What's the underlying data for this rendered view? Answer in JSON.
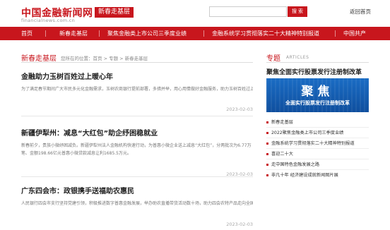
{
  "header": {
    "logo_cn": "中国金融新闻网",
    "logo_en": "financialnews.com.cn",
    "channel": "新春走基层",
    "search_placeholder": "",
    "search_label": "搜 索",
    "home_label": "返回首页"
  },
  "nav": {
    "items": [
      {
        "label": "首页"
      },
      {
        "label": "新春走基层"
      },
      {
        "label": "聚焦金融类上市公司三季度业绩"
      },
      {
        "label": "金融系统学习贯彻落实二十大精神特别报道"
      },
      {
        "label": "中国共产"
      }
    ]
  },
  "main": {
    "section_title": "新春走基层",
    "breadcrumb": "您所在的位置：首页 > 专题 > 新春走基层",
    "articles": [
      {
        "title": "金融助力玉树百姓过上暖心年",
        "summary": "为了满足春节期间广大市民多元化金融需求，玉树农商银行提前部署，多措并举，用心用情做好金融服务，助力玉树百姓过上暖心",
        "date": "2023-02-03"
      },
      {
        "title": "新疆伊犁州：减息“大红包”助企纾困稳就业",
        "summary": "新春前夕，贵族小微纾困减负。新疆伊犁州法人金融机构快速行动，为普惠小微企业送上减息“大红包”，分两批次为6.77万笔、金额198.66亿元普惠小微贷款减息让利1685.5万元。",
        "date": "2023-02-03"
      },
      {
        "title": "广东四会市：政银携手送福助农惠民",
        "summary": "人民银行四会市支行坚持党建引领，积极推进数字普惠金融发展，举办助农直播带货活动数十场，助力四会农特产品走向全国。",
        "date": "2023-02-03"
      }
    ]
  },
  "sidebar": {
    "title": "专题",
    "title_en": "ARTICLES",
    "feature_title": "聚焦全面实行股票发行注册制改革",
    "banner_main": "聚焦",
    "banner_sub": "全面实行股票发行注册制改革",
    "items": [
      {
        "label": "新春走基层"
      },
      {
        "label": "2022聚焦金融类上市公司三季度业绩"
      },
      {
        "label": "金融系统学习贯彻落实二十大精神特别报道"
      },
      {
        "label": "喜迎二十大"
      },
      {
        "label": "走中国特色金融发展之路"
      },
      {
        "label": "非凡十年 经济建设成就新闻图片展"
      }
    ]
  },
  "colors": {
    "brand_red": "#c8161d",
    "banner_blue": "#1a6cc4"
  }
}
